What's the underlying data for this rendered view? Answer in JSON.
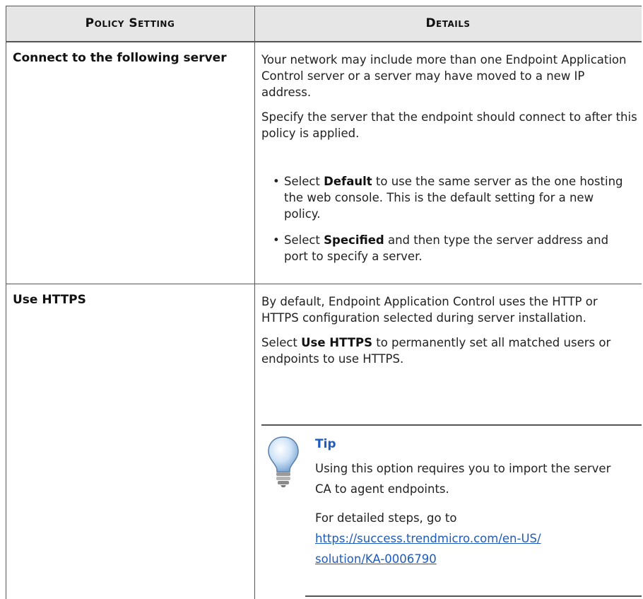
{
  "headers": {
    "col1": "Policy Setting",
    "col2": "Details"
  },
  "rows": [
    {
      "name": "Connect to the following server",
      "p1": "Your network may include more than one Endpoint Application Control server or a server may have moved to a new IP address.",
      "p2": "Specify the server that the endpoint should connect to after this policy is applied.",
      "b1_pre": "Select ",
      "b1_bold": "Default",
      "b1_post": " to use the same server as the one hosting the web console. This is the default setting for a new policy.",
      "b2_pre": "Select ",
      "b2_bold": "Specified",
      "b2_post": " and then type the server address and port to specify a server."
    },
    {
      "name": "Use HTTPS",
      "p1": "By default, Endpoint Application Control uses the HTTP or HTTPS configuration selected during server installation.",
      "p2_pre": "Select ",
      "p2_bold": "Use HTTPS",
      "p2_post": " to permanently set all matched users or endpoints to use HTTPS.",
      "tip": {
        "title": "Tip",
        "text": "Using this option requires you to import the server CA to agent endpoints.",
        "steps_pre": "For detailed steps, go to ",
        "link1": "https://success.trendmicro.com/en-US/",
        "link2": "solution/KA-0006790"
      }
    }
  ],
  "icons": {
    "tip": "lightbulb-icon"
  },
  "colors": {
    "header_bg": "#e6e6e6",
    "link": "#1f5bbf",
    "rule": "#555555"
  }
}
